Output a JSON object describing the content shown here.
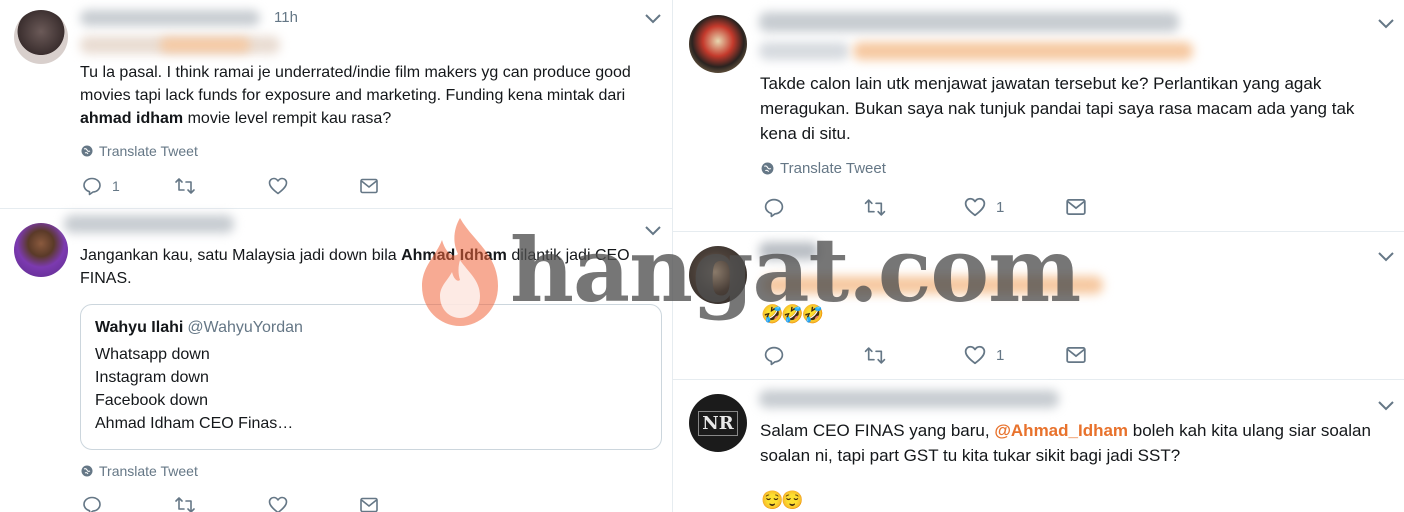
{
  "colors": {
    "text": "#14171a",
    "muted": "#657786",
    "divider": "#e6ecf0",
    "mention": "#e8722c",
    "watermark_flame": "#f0643a",
    "blur_mention": "#f6a766"
  },
  "left": {
    "tweets": [
      {
        "time": "11h",
        "text_parts": [
          "Tu la pasal. I think ramai je underrated/indie film makers yg can produce good\nmovies tapi lack funds for exposure and marketing. Funding kena mintak dari\n",
          "ahmad idham",
          " movie level rempit kau rasa?"
        ],
        "translate": "Translate Tweet",
        "reply_count": "1"
      },
      {
        "text_parts": [
          "Jangankan kau, satu Malaysia jadi down bila ",
          "Ahmad Idham",
          " dilantik jadi CEO\nFINAS."
        ],
        "quote": {
          "name": "Wahyu Ilahi",
          "handle": "@WahyuYordan",
          "body": "Whatsapp down\nInstagram down\nFacebook down\nAhmad Idham CEO Finas…"
        },
        "translate": "Translate Tweet"
      }
    ]
  },
  "right": {
    "tweets": [
      {
        "text": "Takde calon lain utk menjawat jawatan tersebut ke? Perlantikan yang agak\nmeragukan. Bukan saya nak tunjuk pandai tapi saya rasa macam ada yang tak\nkena di situ.",
        "translate": "Translate Tweet",
        "like_count": "1"
      },
      {
        "emoji": "🤣🤣🤣",
        "like_count": "1"
      },
      {
        "avatar_label": "NR",
        "text_parts": [
          "Salam CEO FINAS yang baru, ",
          "@Ahmad_Idham",
          " boleh kah kita ulang siar soalan\nsoalan ni, tapi part GST tu kita tukar sikit bagi jadi SST?"
        ],
        "emoji": "😌😌"
      }
    ]
  },
  "watermark": {
    "text": "hangat.com"
  },
  "icons": {
    "reply": "reply-icon",
    "retweet": "retweet-icon",
    "like": "heart-icon",
    "dm": "envelope-icon",
    "globe": "globe-icon",
    "caret": "chevron-down-icon"
  }
}
